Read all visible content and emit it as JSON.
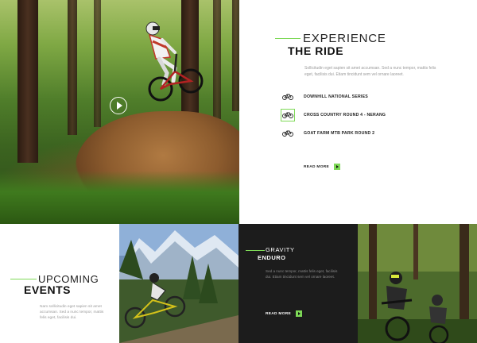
{
  "hero": {
    "image_alt": "Mountain biker jumping over a dirt mound in a forest"
  },
  "experience": {
    "title_light": "EXPERIENCE",
    "title_bold": "THE RIDE",
    "description": "Sollicitudin eget sapien sit amet accumsan. Sed a nunc tempor, mattis felis eget, facilisis dui. Etiam tincidunt sem vel ornare laoreet.",
    "events": [
      {
        "label": "DOWNHILL NATIONAL SERIES",
        "icon": "bike-icon",
        "active": false
      },
      {
        "label": "CROSS COUNTRY ROUND 4 - NERANG",
        "icon": "bike-icon",
        "active": true
      },
      {
        "label": "GOAT FARM MTB PARK ROUND 2",
        "icon": "bike-icon",
        "active": false
      }
    ],
    "read_more": "READ MORE"
  },
  "upcoming": {
    "title_light": "UPCOMING",
    "title_bold": "EVENTS",
    "description": "Nam sollicitudin eget sapien sit amet accumsan. Sed a nunc tempor, mattis felis eget, facilisis dui."
  },
  "gravity": {
    "title_light": "GRAVITY",
    "title_bold": "ENDURO",
    "description": "Sed a nunc tempor, mattis felis eget, facilisis dui. Etiam tincidunt sem vel ornare laoreet.",
    "read_more": "READ MORE"
  },
  "colors": {
    "accent": "#7ed957",
    "dark_panel": "#1c1c1c",
    "body_text": "#9a9a9a"
  }
}
